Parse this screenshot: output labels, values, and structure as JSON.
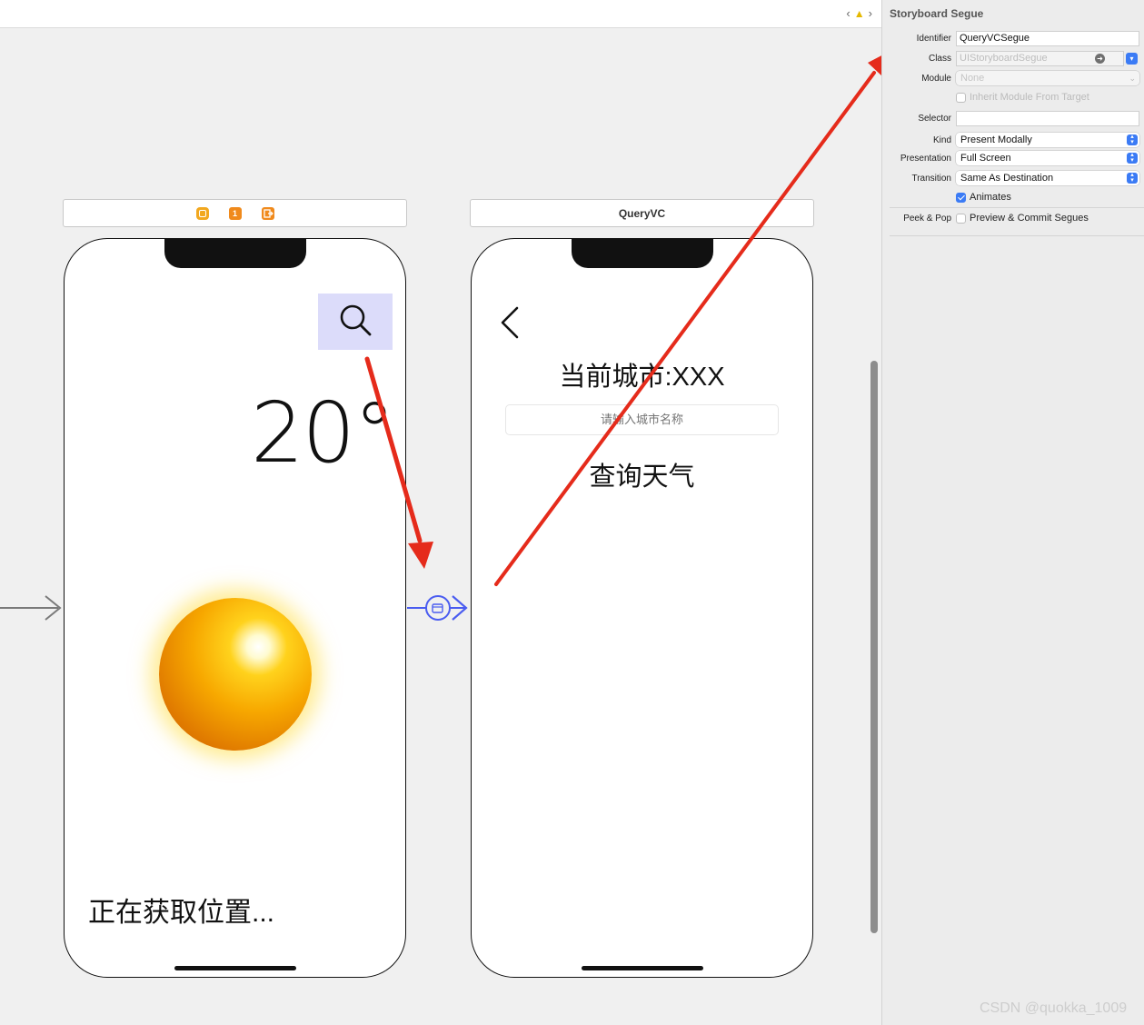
{
  "topbar": {
    "back": "‹",
    "forward": "›",
    "warning": "▲"
  },
  "scenes": {
    "weather": {
      "dock": {
        "vc_icon": "view-controller-icon",
        "first_responder": "1",
        "exit_icon": "exit-icon"
      },
      "temperature": "20°",
      "location": "正在获取位置..."
    },
    "query": {
      "title": "QueryVC",
      "city_label": "当前城市:XXX",
      "city_placeholder": "请输入城市名称",
      "query_button": "查询天气"
    }
  },
  "inspector": {
    "title": "Storyboard Segue",
    "identifier_label": "Identifier",
    "identifier_value": "QueryVCSegue",
    "class_label": "Class",
    "class_placeholder": "UIStoryboardSegue",
    "module_label": "Module",
    "module_placeholder": "None",
    "inherit_label": "Inherit Module From Target",
    "selector_label": "Selector",
    "selector_value": "",
    "kind_label": "Kind",
    "kind_value": "Present Modally",
    "presentation_label": "Presentation",
    "presentation_value": "Full Screen",
    "transition_label": "Transition",
    "transition_value": "Same As Destination",
    "animates_label": "Animates",
    "animates_checked": true,
    "peek_label": "Peek & Pop",
    "peek_option": "Preview & Commit Segues",
    "peek_checked": false
  },
  "watermark": "CSDN @quokka_1009",
  "colors": {
    "annotation_arrow": "#e52b1b",
    "segue": "#4a5cf0",
    "stepper": "#3b7bf5"
  }
}
